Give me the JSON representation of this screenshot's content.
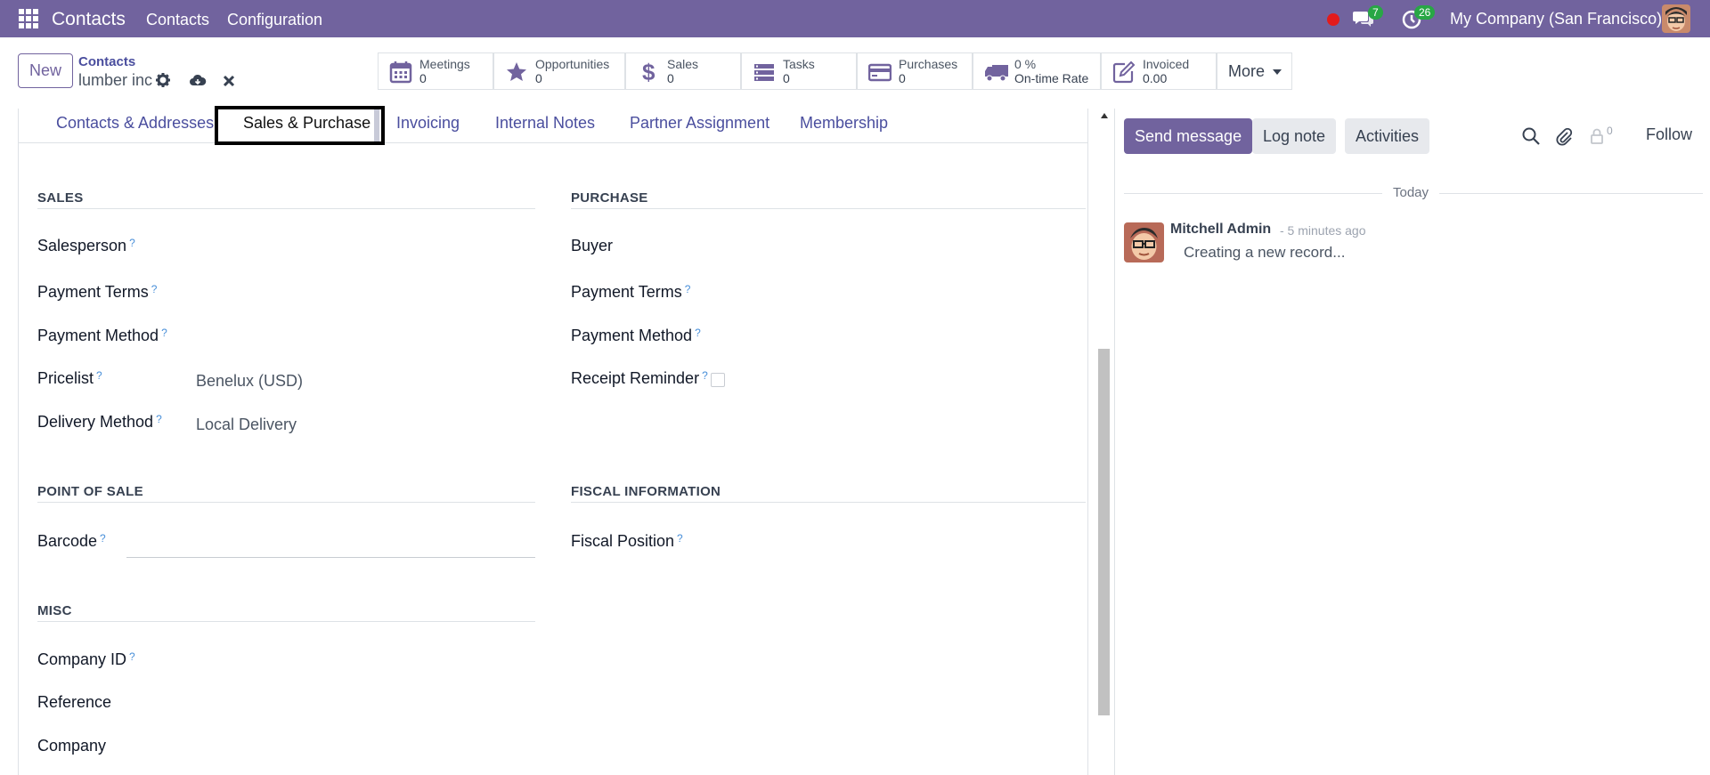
{
  "topnav": {
    "brand": "Contacts",
    "menu": [
      "Contacts",
      "Configuration"
    ],
    "chat_count": "7",
    "activity_count": "26",
    "company": "My Company (San Francisco)",
    "bg_color": "#71639e"
  },
  "control": {
    "new_label": "New",
    "breadcrumb_parent": "Contacts",
    "record_name": "lumber inc",
    "smart_buttons": [
      {
        "icon": "calendar-icon",
        "label": "Meetings",
        "value": "0"
      },
      {
        "icon": "star-icon",
        "label": "Opportunities",
        "value": "0"
      },
      {
        "icon": "dollar-icon",
        "label": "Sales",
        "value": "0"
      },
      {
        "icon": "tasks-icon",
        "label": "Tasks",
        "value": "0"
      },
      {
        "icon": "credit-card-icon",
        "label": "Purchases",
        "value": "0"
      },
      {
        "icon": "truck-icon",
        "label": "0 %",
        "value": "On-time Rate"
      },
      {
        "icon": "pencil-square-icon",
        "label": "Invoiced",
        "value": "0.00"
      }
    ],
    "more_label": "More"
  },
  "tabs": [
    "Contacts & Addresses",
    "Sales & Purchase",
    "Invoicing",
    "Internal Notes",
    "Partner Assignment",
    "Membership"
  ],
  "active_tab": "Sales & Purchase",
  "form": {
    "sales": {
      "title": "SALES",
      "salesperson": "Salesperson",
      "payment_terms": "Payment Terms",
      "payment_method": "Payment Method",
      "pricelist": "Pricelist",
      "pricelist_value": "Benelux (USD)",
      "delivery_method": "Delivery Method",
      "delivery_method_value": "Local Delivery"
    },
    "purchase": {
      "title": "PURCHASE",
      "buyer": "Buyer",
      "payment_terms": "Payment Terms",
      "payment_method": "Payment Method",
      "receipt_reminder": "Receipt Reminder"
    },
    "pos": {
      "title": "POINT OF SALE",
      "barcode": "Barcode"
    },
    "fiscal": {
      "title": "FISCAL INFORMATION",
      "fiscal_position": "Fiscal Position"
    },
    "misc": {
      "title": "MISC",
      "company_id": "Company ID",
      "reference": "Reference",
      "company": "Company"
    },
    "help_mark": "?"
  },
  "chatter": {
    "send_message": "Send message",
    "log_note": "Log note",
    "activities": "Activities",
    "follower_count": "0",
    "follow": "Follow",
    "date_separator": "Today",
    "message": {
      "author": "Mitchell Admin",
      "date": "- 5 minutes ago",
      "body": "Creating a new record..."
    }
  }
}
